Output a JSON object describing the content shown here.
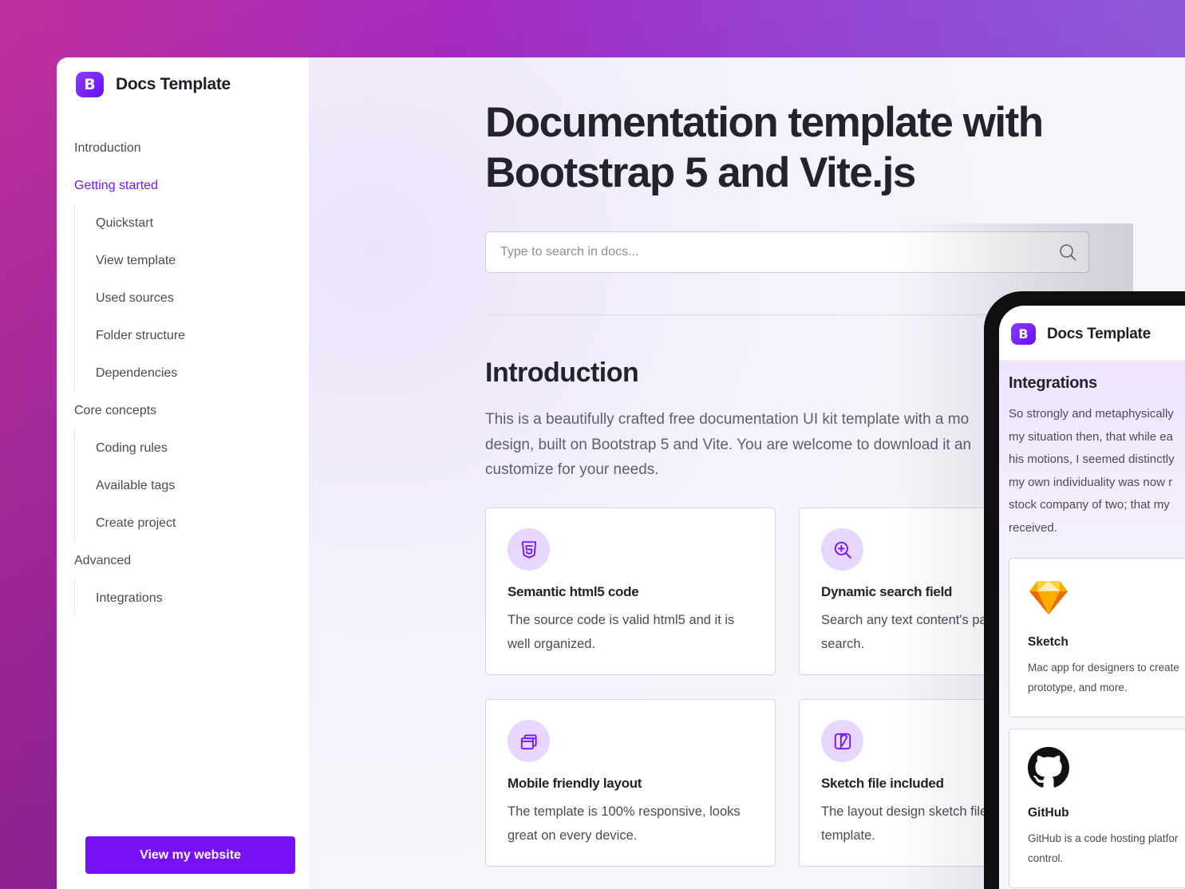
{
  "sidebar": {
    "brand": {
      "logo_letter": "B",
      "name": "Docs Template"
    },
    "groups": [
      {
        "label": "Introduction",
        "active": false,
        "items": []
      },
      {
        "label": "Getting started",
        "active": true,
        "items": [
          "Quickstart",
          "View template",
          "Used sources",
          "Folder structure",
          "Dependencies"
        ]
      },
      {
        "label": "Core concepts",
        "active": false,
        "items": [
          "Coding rules",
          "Available tags",
          "Create project"
        ]
      },
      {
        "label": "Advanced",
        "active": false,
        "items": [
          "Integrations"
        ]
      }
    ],
    "website_button": "View my website"
  },
  "main": {
    "title_line1": "Documentation template with",
    "title_line2": "Bootstrap 5 and Vite.js",
    "search": {
      "placeholder": "Type to search in docs...",
      "icon": "search-icon"
    },
    "section_title": "Introduction",
    "lead_lines": [
      "This is a beautifully crafted free documentation UI kit template with a mo",
      "design, built on Bootstrap 5 and Vite. You are welcome to download it an",
      "customize for your needs."
    ],
    "cards": [
      {
        "icon": "html5-icon",
        "title": "Semantic html5 code",
        "text": "The source code is valid html5 and it is well organized."
      },
      {
        "icon": "zoom-in-icon",
        "title": "Dynamic search field",
        "text": "Search any text content's pa with live search."
      },
      {
        "icon": "stacked-windows-icon",
        "title": "Mobile friendly layout",
        "text": "The template is 100% responsive, looks great on every device."
      },
      {
        "icon": "sketch-file-icon",
        "title": "Sketch file included",
        "text": "The layout design sketch file with the template."
      }
    ]
  },
  "phone": {
    "brand": {
      "logo_letter": "B",
      "name": "Docs Template"
    },
    "section_title": "Integrations",
    "text_lines": [
      "So strongly and metaphysically",
      "my situation then, that while ea",
      "his motions, I seemed distinctly",
      "my own individuality was now r",
      "stock company of two; that my",
      "received."
    ],
    "cards": [
      {
        "icon": "sketch-logo-icon",
        "title": "Sketch",
        "text_lines": [
          "Mac app for designers to create",
          "prototype, and more."
        ]
      },
      {
        "icon": "github-logo-icon",
        "title": "GitHub",
        "text_lines": [
          "GitHub is a code hosting platfor",
          "control."
        ]
      }
    ]
  },
  "colors": {
    "accent": "#7510f7",
    "accent_light": "#e7d6fd",
    "text_dark": "#22232c"
  }
}
